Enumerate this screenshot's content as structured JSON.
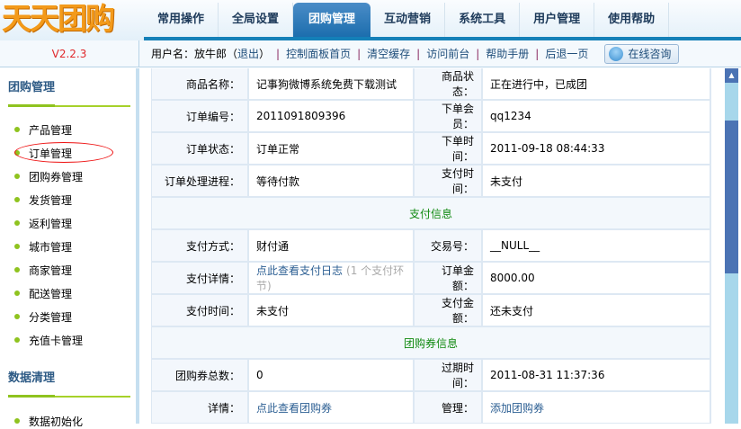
{
  "app": {
    "logo": "天天团购",
    "version": "V2.2.3"
  },
  "nav": {
    "tabs": [
      "常用操作",
      "全局设置",
      "团购管理",
      "互动营销",
      "系统工具",
      "用户管理",
      "使用帮助"
    ],
    "active": 2
  },
  "toolbar": {
    "user_prefix": "用户名：放牛郎（",
    "logout": "退出",
    "user_suffix": "）",
    "links": [
      "控制面板首页",
      "清空缓存",
      "访问前台",
      "帮助手册",
      "后退一页"
    ],
    "consult": "在线咨询"
  },
  "sidebar": {
    "sections": [
      {
        "title": "团购管理",
        "items": [
          "产品管理",
          "订单管理",
          "团购券管理",
          "发货管理",
          "返利管理",
          "城市管理",
          "商家管理",
          "配送管理",
          "分类管理",
          "充值卡管理"
        ]
      },
      {
        "title": "数据清理",
        "items": [
          "数据初始化"
        ]
      }
    ],
    "highlighted": "订单管理"
  },
  "order": {
    "product_name_label": "商品名称：",
    "product_name": "记事狗微博系统免费下载测试",
    "product_status_label": "商品状态：",
    "product_status": "正在进行中，已成团",
    "order_no_label": "订单编号：",
    "order_no": "2011091809396",
    "member_label": "下单会员：",
    "member": "qq1234",
    "order_status_label": "订单状态：",
    "order_status": "订单正常",
    "order_time_label": "下单时间：",
    "order_time": "2011-09-18 08:44:33",
    "progress_label": "订单处理进程：",
    "progress": "等待付款",
    "pay_time_label": "支付时间：",
    "pay_time": "未支付"
  },
  "payment": {
    "section_title": "支付信息",
    "method_label": "支付方式：",
    "method": "财付通",
    "trade_no_label": "交易号：",
    "trade_no": "__NULL__",
    "detail_label": "支付详情：",
    "detail_link": "点此查看支付日志",
    "detail_hint": "(1 个支付环节)",
    "amount_label": "订单金额：",
    "amount": "8000.00",
    "time_label": "支付时间：",
    "time": "未支付",
    "paid_label": "支付金额：",
    "paid": "还未支付"
  },
  "coupon": {
    "section_title": "团购券信息",
    "total_label": "团购券总数：",
    "total": "0",
    "expire_label": "过期时间：",
    "expire": "2011-08-31 11:37:36",
    "detail_label": "详情：",
    "detail_link": "点此查看团购券",
    "manage_label": "管理：",
    "manage_link": "添加团购券"
  }
}
